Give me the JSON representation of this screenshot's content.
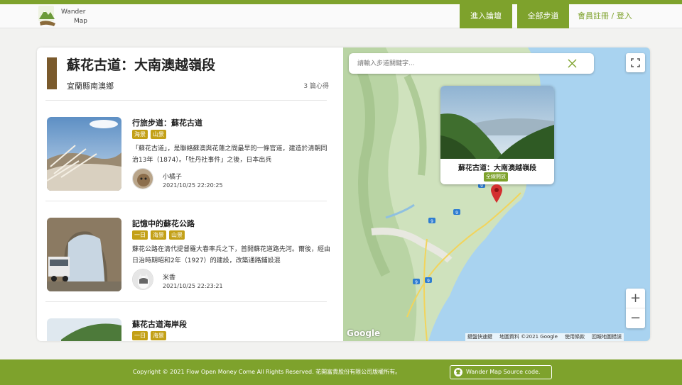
{
  "header": {
    "logo_line1": "Wander",
    "logo_line2": "Map",
    "nav_forum": "進入論壇",
    "nav_all_trails": "全部步道",
    "nav_login": "會員註冊 / 登入"
  },
  "trail": {
    "title": "蘇花古道：大南澳越嶺段",
    "location": "宜蘭縣南澳鄉",
    "post_count": "3 篇心得"
  },
  "posts": [
    {
      "title": "行旅步道：蘇花古道",
      "tags": [
        "海景",
        "山景"
      ],
      "excerpt": "「蘇花古道」，是聯絡蘇澳與花蓮之間最早的一條官道，建造於清朝同治13年（1874）。「牡丹社事件」之後，日本出兵",
      "author": "小橘子",
      "date": "2021/10/25 22:20:25"
    },
    {
      "title": "記憶中的蘇花公路",
      "tags": [
        "一日",
        "海景",
        "山景"
      ],
      "excerpt": "蘇花公路在清代提督羅大春率兵之下，首開蘇花道路先河。爾後，經由日治時期昭和2年（1927）的建設，改築通路鋪設混",
      "author": "米香",
      "date": "2021/10/25 22:23:21"
    },
    {
      "title": "蘇花古道海岸段",
      "tags": [
        "一日",
        "海景"
      ],
      "excerpt": "",
      "author": "",
      "date": ""
    }
  ],
  "map": {
    "search_placeholder": "請輸入步道關鍵字...",
    "popup_title": "蘇花古道：大南澳越嶺段",
    "popup_status": "全線開放",
    "zoom_in": "+",
    "zoom_out": "−",
    "google_logo": "Google",
    "attribution": [
      "鍵盤快速鍵",
      "地圖資料 ©2021 Google",
      "使用條款",
      "回報地圖錯誤"
    ],
    "road_labels": [
      "9",
      "9",
      "9",
      "9",
      "9"
    ]
  },
  "footer": {
    "copyright": "Copyright © 2021 Flow Open Money Come All Rights Reserved. 花開富貴股份有限公司版權所有。",
    "source_link": "Wander Map Source code."
  },
  "colors": {
    "brand_green": "#7ea22c",
    "tag_gold": "#c3a017",
    "title_bar_brown": "#7a5a2c",
    "pin_red": "#d32f2f",
    "sea_blue": "#a9d3f0"
  }
}
